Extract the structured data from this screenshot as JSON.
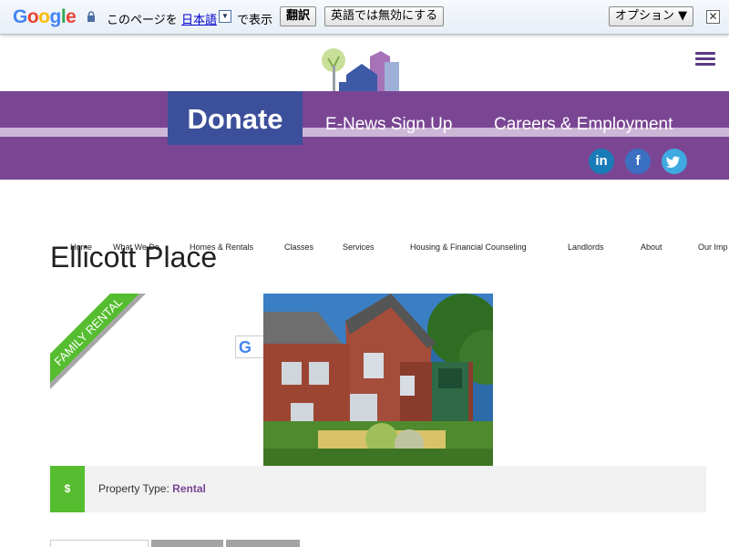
{
  "translate_bar": {
    "brand": "Google",
    "prompt_prefix": "このページを",
    "language": "日本語",
    "prompt_suffix": "で表示",
    "translate_button": "翻訳",
    "never_translate_button": "英語では無効にする",
    "options_button": "オプション ▼",
    "close": "✕"
  },
  "header": {
    "donate_label": "Donate",
    "nav": [
      "E-News Sign Up",
      "Careers & Employment"
    ],
    "social": [
      {
        "name": "linkedin",
        "label": "in",
        "color": "#1a7bb9"
      },
      {
        "name": "facebook",
        "label": "f",
        "color": "#3b6fc1"
      },
      {
        "name": "twitter",
        "label": "t",
        "color": "#3fa9e1"
      }
    ]
  },
  "main_nav": [
    "Home",
    "What We Do",
    "Homes & Rentals",
    "Classes",
    "Services",
    "Housing & Financial Counseling",
    "Landlords",
    "About",
    "Our Imp"
  ],
  "page": {
    "title": "Ellicott Place",
    "ribbon": "FAMILY RENTAL",
    "property_badge": "$",
    "property_type_label": "Property Type:",
    "property_type_value": "Rental"
  },
  "colors": {
    "purple": "#7a4694",
    "donate_blue": "#3c4f9a",
    "green": "#55bd2f"
  }
}
